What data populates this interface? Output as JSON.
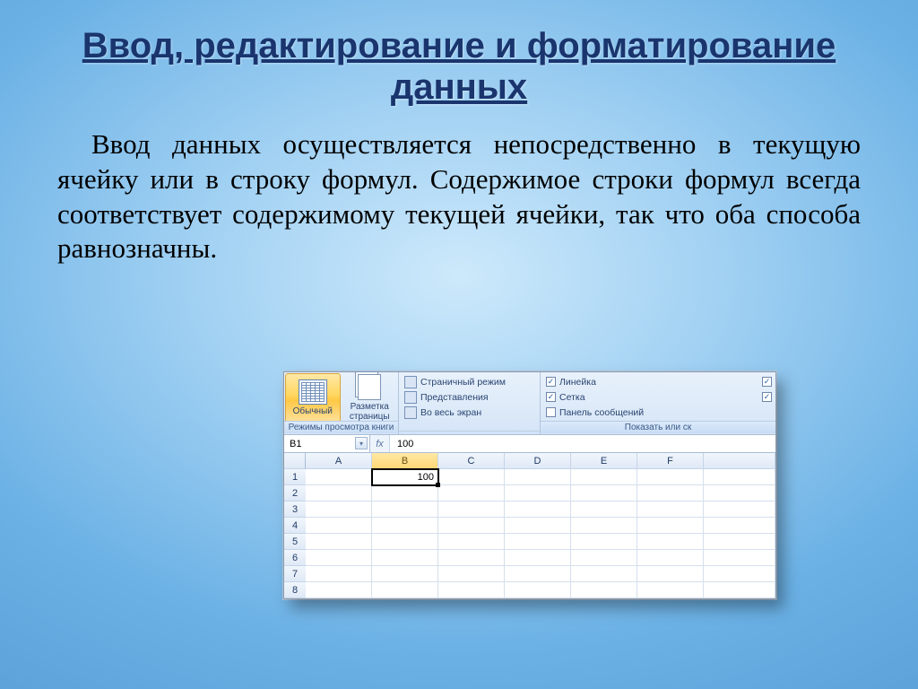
{
  "slide": {
    "title": "Ввод, редактирование и форматирование данных",
    "body": "Ввод данных осуществляется непосредственно в текущую ячейку или в строку формул. Содержимое строки формул всегда соответствует содержимому текущей ячейки, так что оба способа равнозначны."
  },
  "excel": {
    "ribbon": {
      "group_a": {
        "title": "Режимы просмотра книги",
        "btn_normal": "Обычный",
        "btn_layout_line1": "Разметка",
        "btn_layout_line2": "страницы"
      },
      "group_b": {
        "item1": "Страничный режим",
        "item2": "Представления",
        "item3": "Во весь экран"
      },
      "group_c": {
        "title": "Показать или ск",
        "chk1": "Линейка",
        "chk2": "Сетка",
        "chk3": "Панель сообщений"
      }
    },
    "formula_bar": {
      "name_box": "B1",
      "fx_label": "fx",
      "value": "100"
    },
    "columns": [
      "A",
      "B",
      "C",
      "D",
      "E",
      "F"
    ],
    "rows": [
      "1",
      "2",
      "3",
      "4",
      "5",
      "6",
      "7",
      "8"
    ],
    "selected_cell_value": "100"
  }
}
